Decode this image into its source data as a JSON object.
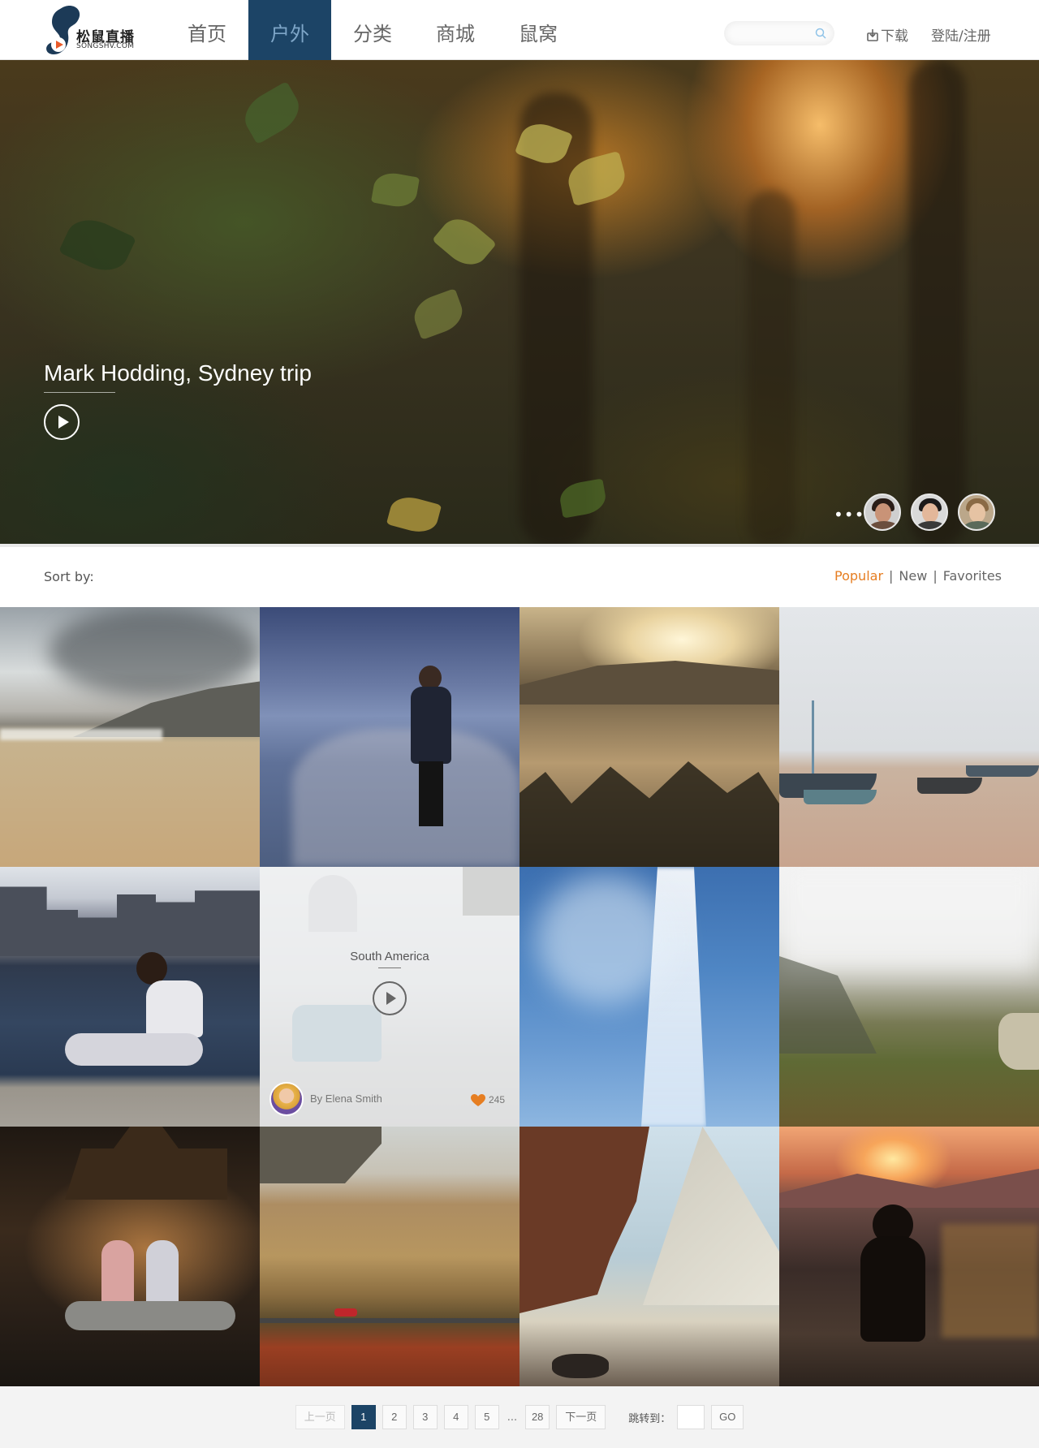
{
  "header": {
    "logo_text": "松鼠直播",
    "logo_sub": "SONGSHV.COM",
    "nav": [
      "首页",
      "户外",
      "分类",
      "商城",
      "鼠窝"
    ],
    "active_nav": "户外",
    "search_placeholder": "",
    "download_label": "下载",
    "login_label": "登陆/注册"
  },
  "hero": {
    "author": "Mark Hodding,",
    "title": "Sydney trip",
    "more_label": "•••"
  },
  "sort": {
    "label": "Sort by:",
    "options": [
      "Popular",
      "New",
      "Favorites"
    ],
    "active": "Popular",
    "separator": "|"
  },
  "featured_tile": {
    "title": "South America",
    "author": "By Elena Smith",
    "likes": "245"
  },
  "pagination": {
    "prev": "上一页",
    "pages": [
      "1",
      "2",
      "3",
      "4",
      "5"
    ],
    "current": "1",
    "ellipsis": "...",
    "last": "28",
    "next": "下一页",
    "jump_label": "跳转到：",
    "go_label": "GO"
  },
  "colors": {
    "nav_active_bg": "#1c4466",
    "accent": "#e67e22"
  }
}
